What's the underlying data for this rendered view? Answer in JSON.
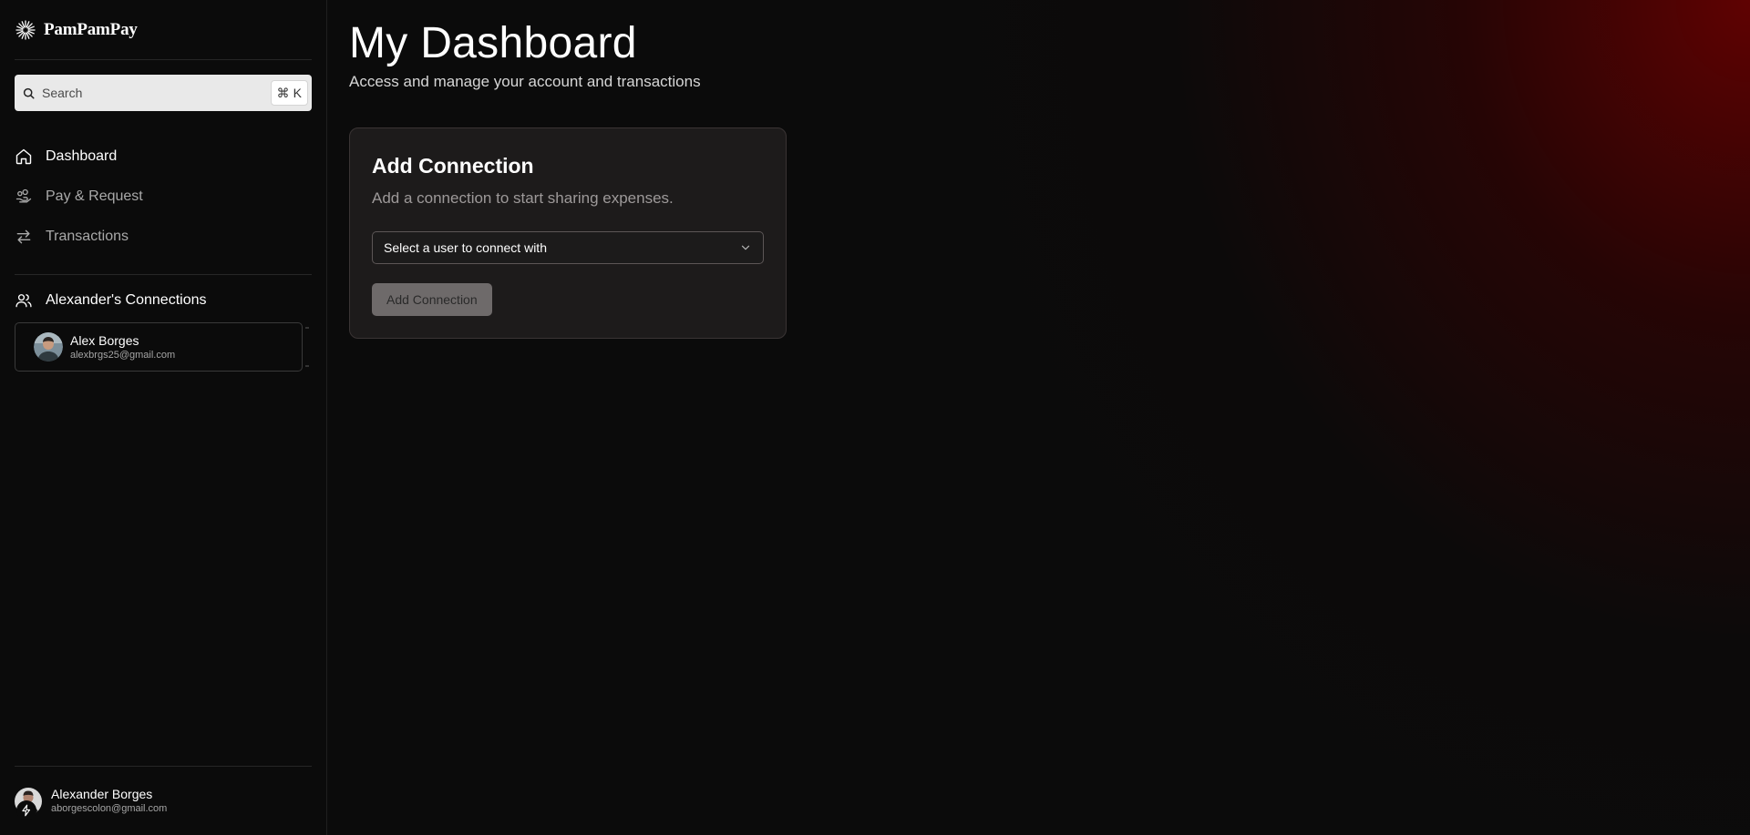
{
  "brand": {
    "name": "PamPamPay",
    "logo_icon": "sunburst-icon"
  },
  "search": {
    "placeholder": "Search",
    "shortcut_symbol": "⌘",
    "shortcut_key": "K"
  },
  "nav": {
    "items": [
      {
        "label": "Dashboard",
        "icon": "home-icon",
        "active": true
      },
      {
        "label": "Pay & Request",
        "icon": "hand-coins-icon",
        "active": false
      },
      {
        "label": "Transactions",
        "icon": "arrows-swap-icon",
        "active": false
      }
    ]
  },
  "connections": {
    "header": "Alexander's Connections",
    "items": [
      {
        "name": "Alex Borges",
        "email": "alexbrgs25@gmail.com"
      }
    ]
  },
  "current_user": {
    "name": "Alexander Borges",
    "email": "aborgescolon@gmail.com"
  },
  "main": {
    "title": "My Dashboard",
    "subtitle": "Access and manage your account and transactions"
  },
  "add_connection_card": {
    "title": "Add Connection",
    "description": "Add a connection to start sharing expenses.",
    "select_placeholder": "Select a user to connect with",
    "button_label": "Add Connection"
  },
  "colors": {
    "background": "#0b0b0b",
    "accent_red": "#6e0000",
    "sidebar_border": "#262626"
  }
}
